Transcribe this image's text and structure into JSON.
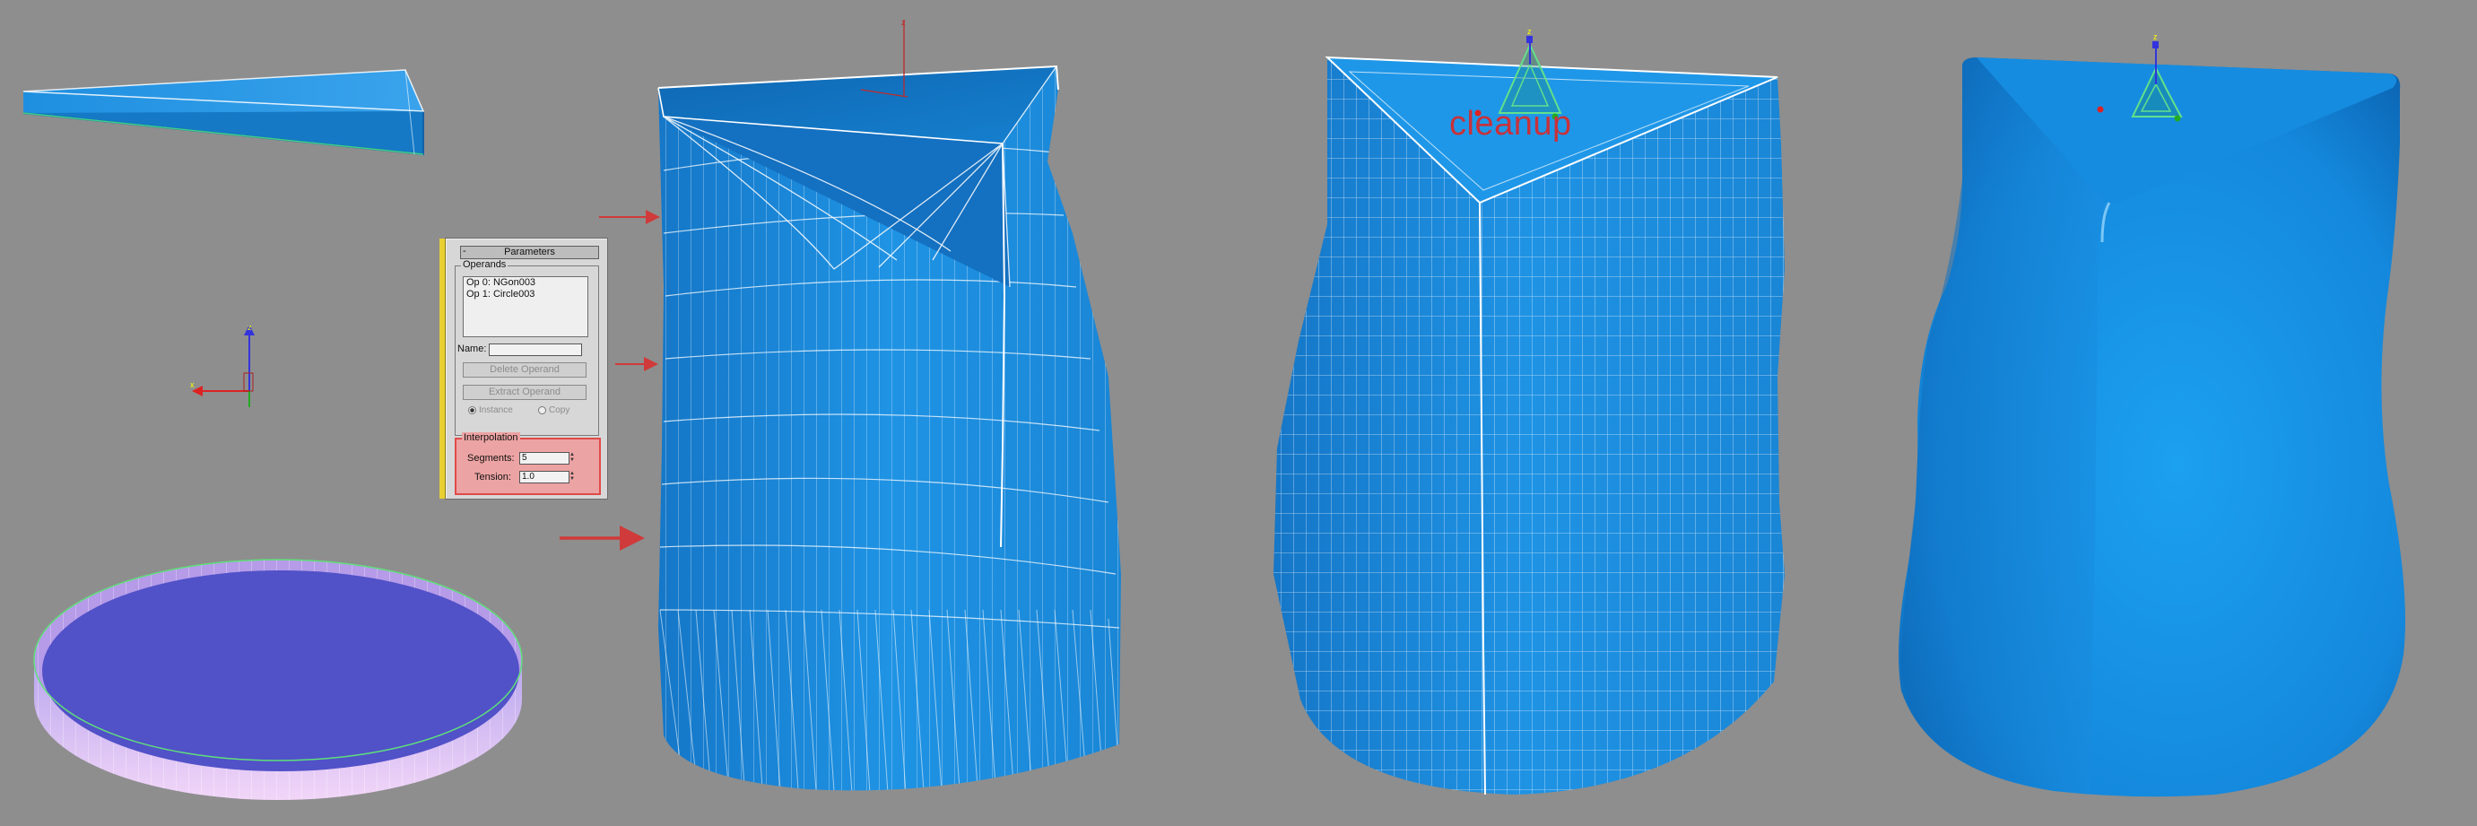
{
  "parameters_panel": {
    "title": "Parameters",
    "collapse_symbol": "-",
    "operands_label": "Operands",
    "operands": [
      "Op 0: NGon003",
      "Op 1: Circle003"
    ],
    "name_label": "Name:",
    "name_value": "",
    "delete_operand_label": "Delete Operand",
    "extract_operand_label": "Extract Operand",
    "instance_label": "Instance",
    "copy_label": "Copy",
    "instance_selected": true,
    "interpolation_label": "Interpolation",
    "segments_label": "Segments:",
    "segments_value": "5",
    "tension_label": "Tension:",
    "tension_value": "1.0"
  },
  "viewport": {
    "cleanup_label": "cleanup",
    "background_color": "#8e8e8e",
    "object_color": "#1a8ee0",
    "disc_color": "#5050c8",
    "arrow_color": "#d03a3a",
    "axis_labels": [
      "x",
      "y",
      "z"
    ]
  }
}
